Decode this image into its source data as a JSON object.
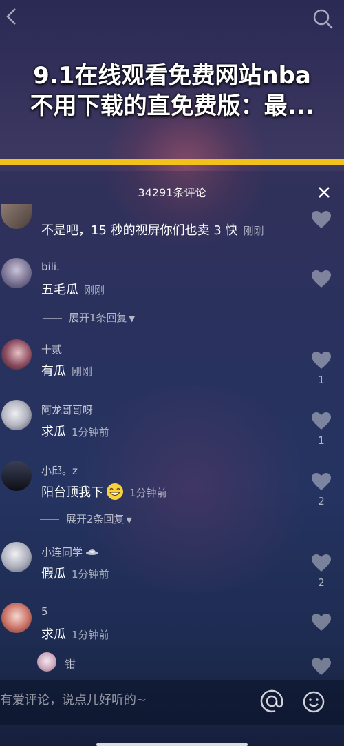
{
  "header": {
    "title_line1": "9.1在线观看免费网站nba",
    "title_line2": "不用下载的直免费版：最..."
  },
  "comments_panel": {
    "count_label": "34291条评论",
    "comments": [
      {
        "user": "",
        "text": "不是吧，15 秒的视屏你们也卖 3 快",
        "time": "刚刚",
        "likes": ""
      },
      {
        "user": "bili.",
        "text": "五毛瓜",
        "time": "刚刚",
        "likes": "",
        "expand": "展开1条回复"
      },
      {
        "user": "十贰",
        "text": "有瓜",
        "time": "刚刚",
        "likes": "1"
      },
      {
        "user": "阿龙哥哥呀",
        "text": "求瓜",
        "time": "1分钟前",
        "likes": "1"
      },
      {
        "user": "小邱。z",
        "text": "阳台顶我下",
        "time": "1分钟前",
        "likes": "2",
        "expand": "展开2条回复"
      },
      {
        "user": "小连同学",
        "text": "假瓜",
        "time": "1分钟前",
        "likes": "2"
      },
      {
        "user": "5",
        "text": "求瓜",
        "time": "1分钟前",
        "likes": ""
      },
      {
        "user": "",
        "text": "钳",
        "time": "",
        "likes": ""
      }
    ]
  },
  "input": {
    "placeholder": "有爱评论，说点儿好听的~"
  },
  "icons": {
    "back": "chevron-left-icon",
    "search": "search-icon",
    "close": "close-icon",
    "like": "heart-icon",
    "mention": "at-icon",
    "emoji": "smile-icon"
  },
  "colors": {
    "accent_bar": "#f2c21a"
  }
}
